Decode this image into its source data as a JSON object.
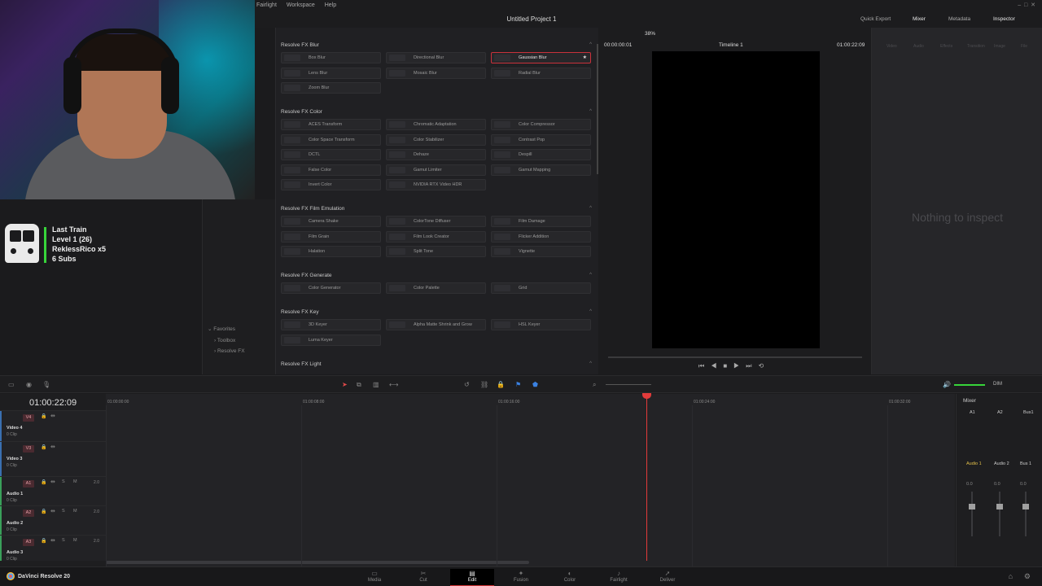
{
  "menu": [
    "Fairlight",
    "Workspace",
    "Help"
  ],
  "project_title": "Untitled Project 1",
  "top_buttons": [
    "Quick Export",
    "Mixer",
    "Metadata",
    "Inspector"
  ],
  "stream_overlay": {
    "label1": "Last Train",
    "label2": "Level 1  (26)",
    "label3": "ReklessRico x5",
    "label4": "6 Subs"
  },
  "bins": [
    "Favorites",
    "Toolbox",
    "Resolve FX"
  ],
  "fx_library": {
    "sections": [
      {
        "title": "Resolve FX Blur",
        "items": [
          "Box Blur",
          "Directional Blur",
          "Gaussian Blur",
          "Lens Blur",
          "Mosaic Blur",
          "Radial Blur",
          "Zoom Blur"
        ]
      },
      {
        "title": "Resolve FX Color",
        "items": [
          "ACES Transform",
          "Chromatic Adaptation",
          "Color Compressor",
          "Color Space Transform",
          "Color Stabilizer",
          "Contrast Pop",
          "DCTL",
          "Dehaze",
          "Despill",
          "False Color",
          "Gamut Limiter",
          "Gamut Mapping",
          "Invert Color",
          "NVIDIA RTX Video HDR"
        ]
      },
      {
        "title": "Resolve FX Film Emulation",
        "items": [
          "Camera Shake",
          "ColorTone Diffuser",
          "Film Damage",
          "Film Grain",
          "Film Look Creator",
          "Flicker Addition",
          "Halation",
          "Split Tone",
          "Vignette"
        ]
      },
      {
        "title": "Resolve FX Generate",
        "items": [
          "Color Generator",
          "Color Palette",
          "Grid"
        ]
      },
      {
        "title": "Resolve FX Key",
        "items": [
          "3D Keyer",
          "Alpha Matte Shrink and Grow",
          "HSL Keyer",
          "Luma Keyer"
        ]
      },
      {
        "title": "Resolve FX Light",
        "items": []
      }
    ],
    "selected": "Gaussian Blur",
    "favorite_star": "★"
  },
  "viewer": {
    "zoom": "38%",
    "timecode_left": "00:00:00:01",
    "timeline_name": "Timeline 1",
    "timecode_right": "01:00:22:09"
  },
  "inspector": {
    "empty_text": "Nothing to inspect",
    "tabs": [
      "Video",
      "Audio",
      "Effects",
      "Transition",
      "Image",
      "File"
    ]
  },
  "timeline": {
    "timecode": "01:00:22:09",
    "ruler": [
      "01:00:00:00",
      "01:00:08:00",
      "01:00:16:00",
      "01:00:24:00",
      "01:00:32:00"
    ],
    "tracks": [
      {
        "badge": "V4",
        "name": "Video 4",
        "clips": "0 Clip",
        "vol": "",
        "kind": "video"
      },
      {
        "badge": "V3",
        "name": "Video 3",
        "clips": "0 Clip",
        "vol": "",
        "kind": "video"
      },
      {
        "badge": "A1",
        "name": "Audio 1",
        "clips": "0 Clip",
        "vol": "2.0",
        "kind": "audio"
      },
      {
        "badge": "A2",
        "name": "Audio 2",
        "clips": "0 Clip",
        "vol": "2.0",
        "kind": "audio"
      },
      {
        "badge": "A3",
        "name": "Audio 3",
        "clips": "0 Clip",
        "vol": "2.0",
        "kind": "audio"
      }
    ],
    "dim_label": "DIM"
  },
  "mixer": {
    "title": "Mixer",
    "columns": [
      "A1",
      "A2",
      "Bus1"
    ],
    "channels": [
      "Audio 1",
      "Audio 2",
      "Bus 1"
    ],
    "levels": [
      "0.0",
      "0.0",
      "0.0"
    ]
  },
  "app_name": "DaVinci Resolve 20",
  "pages": [
    {
      "label": "Media",
      "icon": "▭"
    },
    {
      "label": "Cut",
      "icon": "✂"
    },
    {
      "label": "Edit",
      "icon": "▤"
    },
    {
      "label": "Fusion",
      "icon": "✦"
    },
    {
      "label": "Color",
      "icon": "◐"
    },
    {
      "label": "Fairlight",
      "icon": "♪"
    },
    {
      "label": "Deliver",
      "icon": "➚"
    }
  ],
  "active_page": "Edit",
  "colors": {
    "accent": "#c9313b",
    "playhead": "#e23b3b",
    "train_bar": "#37d43a"
  }
}
